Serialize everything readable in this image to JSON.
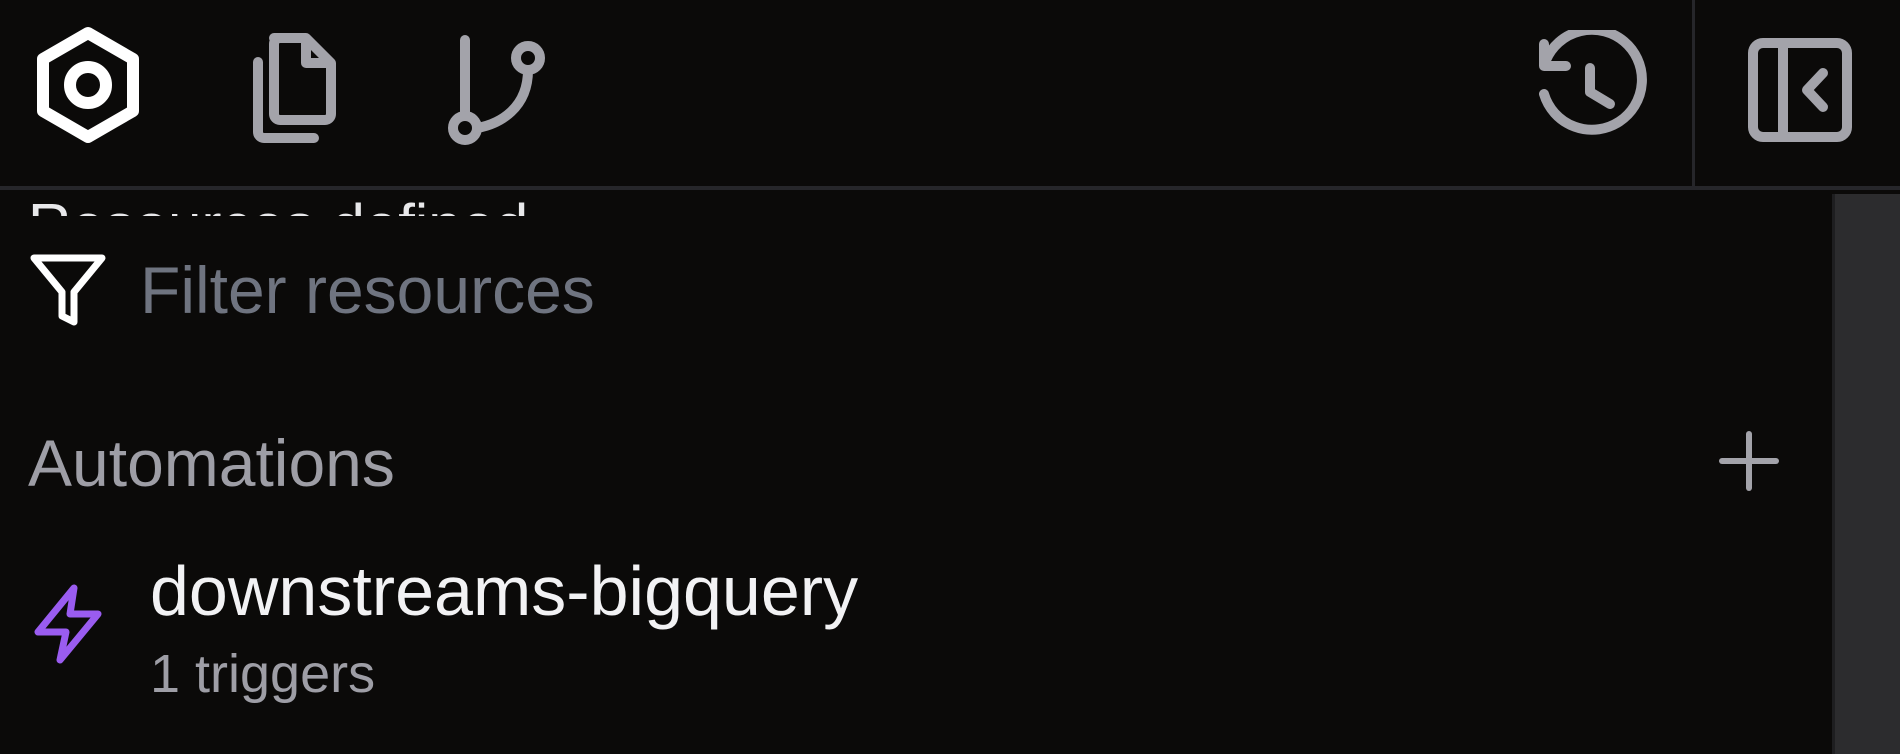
{
  "toolbar": {
    "icons": {
      "settings": "hexagon-settings-icon",
      "files": "files-icon",
      "git": "git-branch-icon",
      "history": "history-icon",
      "collapse": "panel-collapse-icon"
    }
  },
  "peek": {
    "text": "Resources defined"
  },
  "filter": {
    "placeholder": "Filter resources",
    "value": ""
  },
  "section": {
    "title": "Automations",
    "add_icon": "plus-icon"
  },
  "items": [
    {
      "name": "downstreams-bigquery",
      "subtitle": "1 triggers",
      "icon": "lightning-bolt-icon",
      "icon_color": "#9a5cf0"
    }
  ],
  "colors": {
    "background": "#0b0a09",
    "icon_gray": "#a3a3aa",
    "accent": "#9a5cf0",
    "text_primary": "#f2f2f4",
    "text_secondary": "#9e9ea6",
    "placeholder": "#6f7480"
  }
}
